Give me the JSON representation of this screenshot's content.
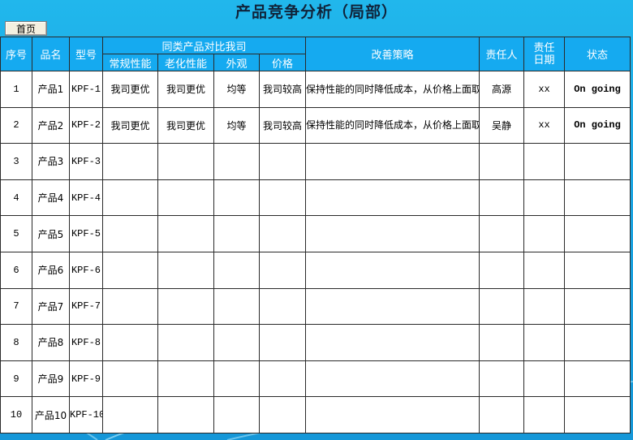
{
  "title": "产品竞争分析（局部）",
  "home_button": "首页",
  "headers": {
    "seq": "序号",
    "name": "品名",
    "model": "型号",
    "compare_group": "同类产品对比我司",
    "performance": "常规性能",
    "aging": "老化性能",
    "appearance": "外观",
    "price": "价格",
    "strategy": "改善策略",
    "owner": "责任人",
    "due_line1": "责任",
    "due_line2": "日期",
    "status": "状态"
  },
  "rows": [
    {
      "seq": "1",
      "name": "产品1",
      "model": "KPF-1",
      "performance": "我司更优",
      "aging": "我司更优",
      "appearance": "均等",
      "price": "我司较高",
      "strategy": "保持性能的同时降低成本，从价格上面取得优势",
      "owner": "高源",
      "due": "xx",
      "status": "On going"
    },
    {
      "seq": "2",
      "name": "产品2",
      "model": "KPF-2",
      "performance": "我司更优",
      "aging": "我司更优",
      "appearance": "均等",
      "price": "我司较高",
      "strategy": "保持性能的同时降低成本，从价格上面取得优势",
      "owner": "吴静",
      "due": "xx",
      "status": "On going"
    },
    {
      "seq": "3",
      "name": "产品3",
      "model": "KPF-3",
      "performance": "",
      "aging": "",
      "appearance": "",
      "price": "",
      "strategy": "",
      "owner": "",
      "due": "",
      "status": ""
    },
    {
      "seq": "4",
      "name": "产品4",
      "model": "KPF-4",
      "performance": "",
      "aging": "",
      "appearance": "",
      "price": "",
      "strategy": "",
      "owner": "",
      "due": "",
      "status": ""
    },
    {
      "seq": "5",
      "name": "产品5",
      "model": "KPF-5",
      "performance": "",
      "aging": "",
      "appearance": "",
      "price": "",
      "strategy": "",
      "owner": "",
      "due": "",
      "status": ""
    },
    {
      "seq": "6",
      "name": "产品6",
      "model": "KPF-6",
      "performance": "",
      "aging": "",
      "appearance": "",
      "price": "",
      "strategy": "",
      "owner": "",
      "due": "",
      "status": ""
    },
    {
      "seq": "7",
      "name": "产品7",
      "model": "KPF-7",
      "performance": "",
      "aging": "",
      "appearance": "",
      "price": "",
      "strategy": "",
      "owner": "",
      "due": "",
      "status": ""
    },
    {
      "seq": "8",
      "name": "产品8",
      "model": "KPF-8",
      "performance": "",
      "aging": "",
      "appearance": "",
      "price": "",
      "strategy": "",
      "owner": "",
      "due": "",
      "status": ""
    },
    {
      "seq": "9",
      "name": "产品9",
      "model": "KPF-9",
      "performance": "",
      "aging": "",
      "appearance": "",
      "price": "",
      "strategy": "",
      "owner": "",
      "due": "",
      "status": ""
    },
    {
      "seq": "10",
      "name": "产品10",
      "model": "KPF-10",
      "performance": "",
      "aging": "",
      "appearance": "",
      "price": "",
      "strategy": "",
      "owner": "",
      "due": "",
      "status": ""
    }
  ]
}
